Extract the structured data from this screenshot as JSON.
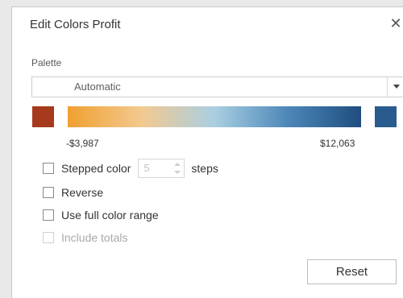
{
  "dialog": {
    "title": "Edit Colors Profit",
    "close_glyph": "✕"
  },
  "palette": {
    "label": "Palette",
    "selected": "Automatic"
  },
  "colors": {
    "negative_end": "#a63a1c",
    "gradient_stops": [
      "#f0a030",
      "#f3c98f",
      "#a9cfe2",
      "#4d87b8",
      "#1f4d80"
    ],
    "positive_end": "#2a5b8e"
  },
  "range": {
    "min": "-$3,987",
    "max": "$12,063"
  },
  "options": {
    "stepped_color": "Stepped color",
    "steps_value": "5",
    "steps_label": "steps",
    "reverse": "Reverse",
    "full_range": "Use full color range",
    "include_totals": "Include totals"
  },
  "buttons": {
    "reset": "Reset"
  }
}
